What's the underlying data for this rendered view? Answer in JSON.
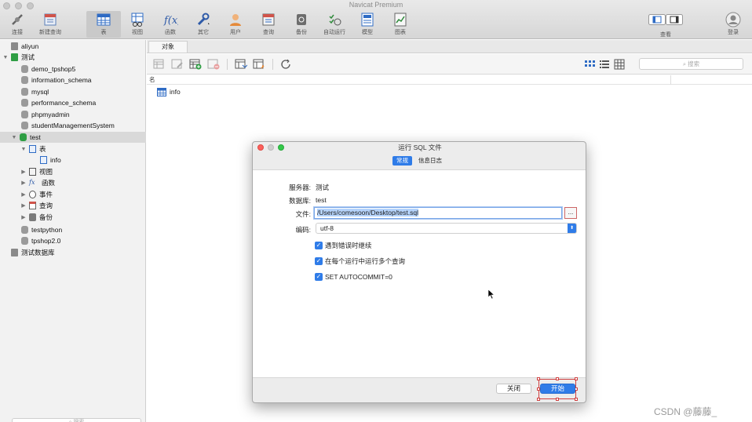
{
  "window": {
    "title": "Navicat Premium"
  },
  "toolbar": {
    "connect": "连接",
    "new_query": "新建查询",
    "table": "表",
    "view": "视图",
    "function": "函数",
    "other": "其它",
    "user": "用户",
    "query": "查询",
    "backup": "备份",
    "auto_run": "自动运行",
    "model": "模型",
    "chart": "图表",
    "view_mode": "查看",
    "login": "登录"
  },
  "sidebar": {
    "items": [
      {
        "label": "aliyun"
      },
      {
        "label": "测试"
      },
      {
        "label": "demo_tpshop5"
      },
      {
        "label": "information_schema"
      },
      {
        "label": "mysql"
      },
      {
        "label": "performance_schema"
      },
      {
        "label": "phpmyadmin"
      },
      {
        "label": "studentManagementSystem"
      },
      {
        "label": "test"
      },
      {
        "label": "表"
      },
      {
        "label": "info"
      },
      {
        "label": "视图"
      },
      {
        "label": "函数"
      },
      {
        "label": "事件"
      },
      {
        "label": "查询"
      },
      {
        "label": "备份"
      },
      {
        "label": "testpython"
      },
      {
        "label": "tpshop2.0"
      },
      {
        "label": "测试数据库"
      }
    ],
    "search_placeholder": "搜索"
  },
  "main": {
    "tab_objects": "对象",
    "search_placeholder": "搜索",
    "column_name": "名",
    "objects": [
      {
        "name": "info"
      }
    ]
  },
  "dialog": {
    "title": "运行 SQL 文件",
    "tab_general": "常规",
    "tab_log": "信息日志",
    "server_label": "服务器:",
    "server_value": "测试",
    "database_label": "数据库:",
    "database_value": "test",
    "file_label": "文件:",
    "file_value": "/Users/comesoon/Desktop/test.sql",
    "browse": "...",
    "encoding_label": "编码:",
    "encoding_value": "utf-8",
    "options": [
      {
        "label": "遇到错误时继续",
        "checked": true
      },
      {
        "label": "在每个运行中运行多个查询",
        "checked": true
      },
      {
        "label": "SET AUTOCOMMIT=0",
        "checked": true
      }
    ],
    "close_button": "关闭",
    "start_button": "开始"
  },
  "watermark": "CSDN @藤藤_",
  "colors": {
    "accent": "#2f7ce8",
    "selection_frame": "#d04040"
  }
}
